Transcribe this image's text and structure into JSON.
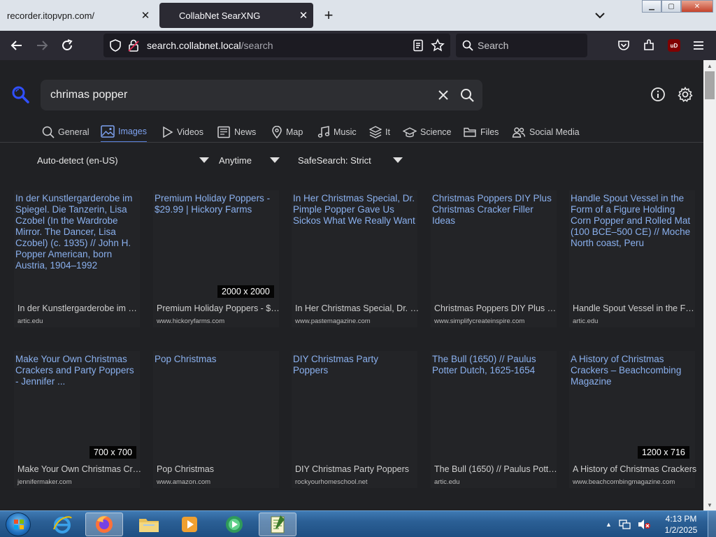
{
  "browser": {
    "tabs": [
      {
        "title": "recorder.itopvpn.com/",
        "active": false
      },
      {
        "title": "CollabNet SearXNG",
        "active": true
      }
    ],
    "url_host": "search.collabnet.local",
    "url_path": "/search",
    "search_placeholder": "Search",
    "ublock_label": "uD"
  },
  "searx": {
    "query": "chrimas popper",
    "categories": [
      {
        "label": "General",
        "icon": "search-icon"
      },
      {
        "label": "Images",
        "icon": "image-icon",
        "active": true
      },
      {
        "label": "Videos",
        "icon": "play-icon"
      },
      {
        "label": "News",
        "icon": "newspaper-icon"
      },
      {
        "label": "Map",
        "icon": "map-pin-icon"
      },
      {
        "label": "Music",
        "icon": "music-note-icon"
      },
      {
        "label": "It",
        "icon": "layers-icon"
      },
      {
        "label": "Science",
        "icon": "graduation-cap-icon"
      },
      {
        "label": "Files",
        "icon": "folder-icon"
      },
      {
        "label": "Social Media",
        "icon": "people-icon"
      }
    ],
    "filters": {
      "language": "Auto-detect (en-US)",
      "time": "Anytime",
      "safesearch": "SafeSearch: Strict"
    },
    "results": [
      {
        "title": "In der Kunstlergarderobe im Spiegel. Die Tanzerin, Lisa Czobel (In the Wardrobe Mirror. The Dancer, Lisa Czobel) (c. 1935) // John H. Popper American, born Austria, 1904–1992",
        "desc": "In der Kunstlergarderobe im Spiegel...",
        "source": "artic.edu",
        "resolution": ""
      },
      {
        "title": "Premium Holiday Poppers - $29.99 | Hickory Farms",
        "desc": "Premium Holiday Poppers - $29.99",
        "source": "www.hickoryfarms.com",
        "resolution": "2000 x 2000"
      },
      {
        "title": "In Her Christmas Special, Dr. Pimple Popper Gave Us Sickos What We Really Want",
        "desc": "In Her Christmas Special, Dr. Pimple",
        "source": "www.pastemagazine.com",
        "resolution": ""
      },
      {
        "title": "Christmas Poppers DIY Plus Christmas Cracker Filler Ideas",
        "desc": "Christmas Poppers DIY Plus Christmas",
        "source": "www.simplifycreateinspire.com",
        "resolution": ""
      },
      {
        "title": "Handle Spout Vessel in the Form of a Figure Holding Corn Popper and Rolled Mat (100 BCE–500 CE) // Moche North coast, Peru",
        "desc": "Handle Spout Vessel in the Form of",
        "source": "artic.edu",
        "resolution": ""
      },
      {
        "title": "Make Your Own Christmas Crackers and Party Poppers - Jennifer ...",
        "desc": "Make Your Own Christmas Crackers",
        "source": "jennifermaker.com",
        "resolution": "700 x 700"
      },
      {
        "title": "Pop Christmas",
        "desc": "Pop Christmas",
        "source": "www.amazon.com",
        "resolution": ""
      },
      {
        "title": "DIY Christmas Party Poppers",
        "desc": "DIY Christmas Party Poppers",
        "source": "rockyourhomeschool.net",
        "resolution": ""
      },
      {
        "title": "The Bull (1650) // Paulus Potter Dutch, 1625-1654",
        "desc": "The Bull (1650) // Paulus Potter Dutch",
        "source": "artic.edu",
        "resolution": ""
      },
      {
        "title": "A History of Christmas Crackers – Beachcombing Magazine",
        "desc": "A History of Christmas Crackers",
        "source": "www.beachcombingmagazine.com",
        "resolution": "1200 x 716"
      }
    ]
  },
  "taskbar": {
    "apps": [
      "internet-explorer-icon",
      "firefox-icon",
      "file-explorer-icon",
      "media-player-icon",
      "media-center-icon",
      "notepad-icon"
    ],
    "time": "4:13 PM",
    "date": "1/2/2025"
  }
}
